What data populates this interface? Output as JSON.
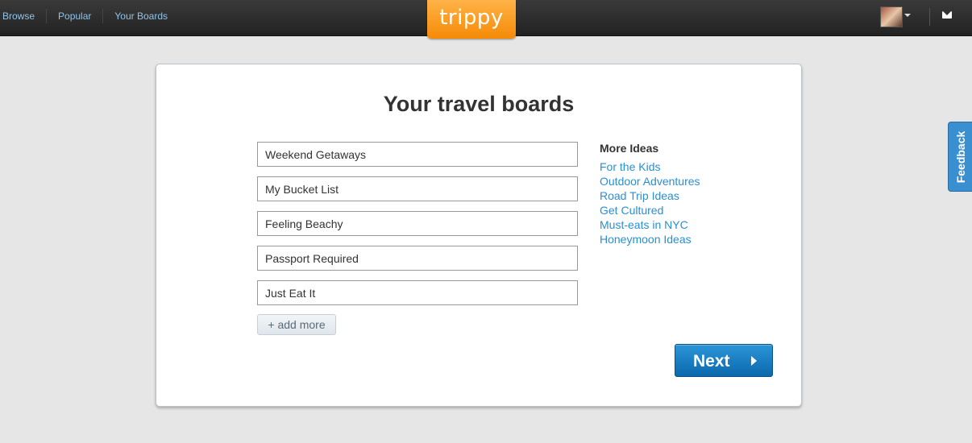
{
  "nav": {
    "items": [
      "Browse",
      "Popular",
      "Your Boards"
    ]
  },
  "logo": {
    "text": "trippy"
  },
  "header_icons": {
    "avatar": "user-avatar",
    "mail": "mail-icon"
  },
  "main": {
    "title": "Your travel boards",
    "boards": [
      "Weekend Getaways",
      "My Bucket List",
      "Feeling Beachy",
      "Passport Required",
      "Just Eat It"
    ],
    "add_more_label": "+ add more",
    "next_label": "Next"
  },
  "ideas": {
    "heading": "More Ideas",
    "items": [
      "For the Kids",
      "Outdoor Adventures",
      "Road Trip Ideas",
      "Get Cultured",
      "Must-eats in NYC",
      "Honeymoon Ideas"
    ]
  },
  "feedback": {
    "label": "Feedback"
  },
  "colors": {
    "accent": "#f58a07",
    "link": "#2a8fd1",
    "button": "#1a7fc4"
  }
}
